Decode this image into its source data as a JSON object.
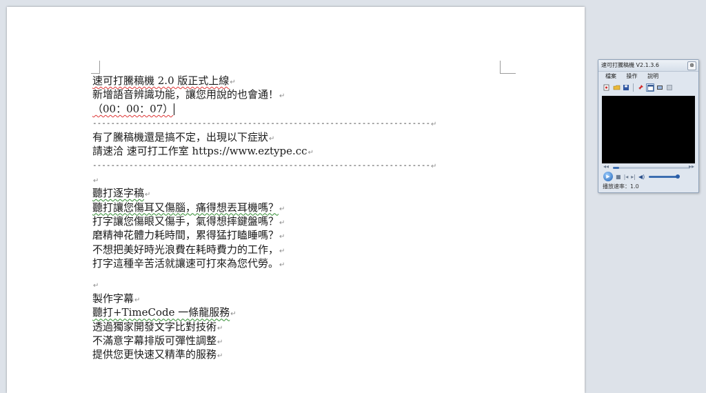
{
  "document": {
    "lines_block1": [
      "速可打騰稿機 2.0 版正式上線",
      "新增語音辨識功能，讓您用說的也會通！",
      "（00：00：07）"
    ],
    "separator": "-----------------------------------------------------------------------------------------------------------",
    "lines_block2": [
      "有了騰稿機還是搞不定，出現以下症狀",
      "請速洽  速可打工作室  https://www.eztype.cc"
    ],
    "section1_title": "聽打逐字稿",
    "section1_lines": [
      "聽打讓您傷耳又傷腦，痛得想丟耳機嗎？",
      "打字讓您傷眼又傷手，氣得想摔鍵盤嗎？",
      "磨精神花體力耗時間，累得猛打瞌睡嗎？",
      "不想把美好時光浪費在耗時費力的工作，",
      "打字這種辛苦活就讓速可打來為您代勞。"
    ],
    "section2_title": "製作字幕",
    "section2_lines": [
      "聽打+TimeCode 一條龍服務",
      "透過獨家開發文字比對技術",
      "不滿意字幕排版可彈性調整",
      "提供您更快速又精準的服務"
    ],
    "para_mark": "↵"
  },
  "player": {
    "title": "速可打騰稿機 V2.1.3.6",
    "close": "⊗",
    "menu": [
      "檔案",
      "操作",
      "說明"
    ],
    "toolbar_icons": [
      "open-file-icon",
      "folder-icon",
      "save-icon",
      "pin-icon",
      "window-icon",
      "video-icon",
      "settings-icon"
    ],
    "seek_progress": 0.08,
    "volume_level": 1.0,
    "speed_text": "播放速率：1.0",
    "accent": "#3b6db0"
  }
}
